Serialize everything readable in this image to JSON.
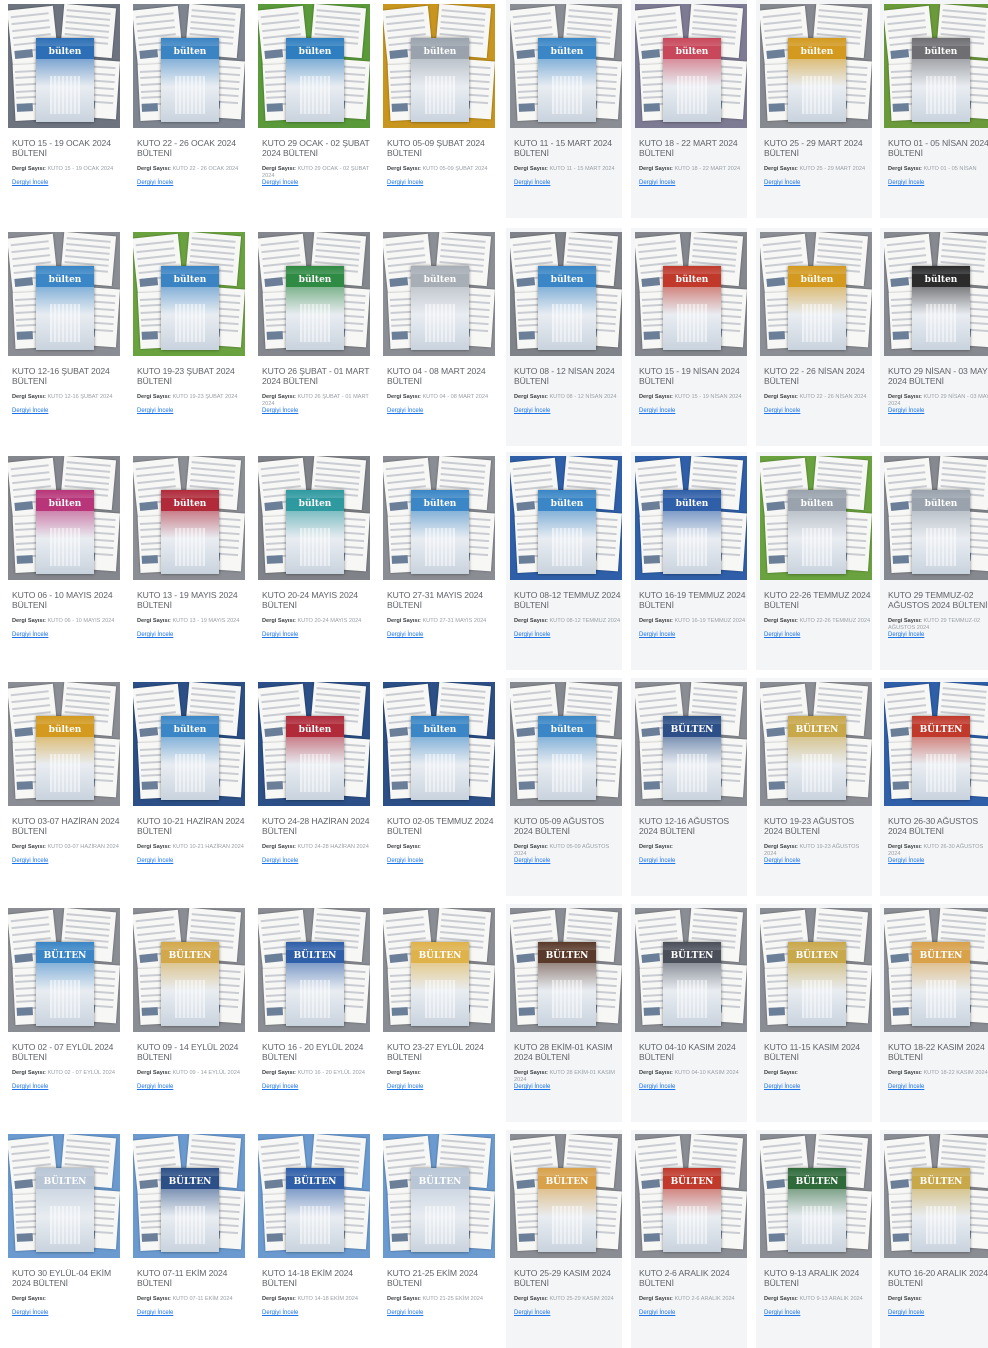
{
  "labels": {
    "issue": "Dergi Sayısı:",
    "link": "Dergiyi İncele"
  },
  "items": [
    {
      "title": "KUTO 15 - 19 OCAK 2024 BÜLTENİ",
      "issue": "KUTO 15 - 19 OCAK 2024",
      "bg": "#6d7480",
      "cover": "#2c6fb6",
      "word": "bülten"
    },
    {
      "title": "KUTO 22 - 26 OCAK 2024 BÜLTENİ",
      "issue": "KUTO 22 - 26 OCAK 2024",
      "bg": "#7e8590",
      "cover": "#3b84c4",
      "word": "bülten"
    },
    {
      "title": "KUTO 29 OCAK - 02 ŞUBAT 2024 BÜLTENİ",
      "issue": "KUTO 29 OCAK - 02 ŞUBAT 2024",
      "bg": "#5a9a3a",
      "cover": "#2f7fc0",
      "word": "bülten"
    },
    {
      "title": "KUTO 05-09 ŞUBAT 2024 BÜLTENİ",
      "issue": "KUTO 05-09 ŞUBAT 2024",
      "bg": "#c8951e",
      "cover": "#9aa3ad",
      "word": "bülten"
    },
    {
      "title": "KUTO 11 - 15 MART 2024 BÜLTENİ",
      "issue": "KUTO 11 - 15 MART 2024",
      "bg": "#8a8d93",
      "cover": "#3a86c6",
      "word": "bülten"
    },
    {
      "title": "KUTO 18 - 22 MART 2024 BÜLTENİ",
      "issue": "KUTO 18 - 22 MART 2024",
      "bg": "#7d7a93",
      "cover": "#c9475a",
      "word": "bülten"
    },
    {
      "title": "KUTO 25 - 29 MART 2024 BÜLTENİ",
      "issue": "KUTO 25 - 29 MART 2024",
      "bg": "#86898f",
      "cover": "#d39a1f",
      "word": "bülten"
    },
    {
      "title": "KUTO 01 - 05 NİSAN 2024 BÜLTENİ",
      "issue": "KUTO 01 - 05 NİSAN",
      "bg": "#6b9a3b",
      "cover": "#6f6f73",
      "word": "bülten"
    },
    {
      "title": "KUTO 12-16 ŞUBAT 2024 BÜLTENİ",
      "issue": "KUTO 12-16 ŞUBAT 2024",
      "bg": "#8a8d93",
      "cover": "#3a86c6",
      "word": "bülten"
    },
    {
      "title": "KUTO 19-23 ŞUBAT 2024 BÜLTENİ",
      "issue": "KUTO 19-23 ŞUBAT 2024",
      "bg": "#6aa23f",
      "cover": "#3b84c4",
      "word": "bülten"
    },
    {
      "title": "KUTO 26 ŞUBAT - 01 MART 2024 BÜLTENİ",
      "issue": "KUTO 26 ŞUBAT - 01 MART 2024",
      "bg": "#84878d",
      "cover": "#2f8a43",
      "word": "bülten"
    },
    {
      "title": "KUTO 04 - 08 MART 2024 BÜLTENİ",
      "issue": "KUTO 04 - 08 MART 2024",
      "bg": "#8b8e94",
      "cover": "#a8aeb6",
      "word": "bülten"
    },
    {
      "title": "KUTO 08 - 12 NİSAN 2024 BÜLTENİ",
      "issue": "KUTO 08 - 12 NİSAN 2024",
      "bg": "#7f8288",
      "cover": "#3a86c6",
      "word": "bülten"
    },
    {
      "title": "KUTO 15 - 19 NİSAN 2024 BÜLTENİ",
      "issue": "KUTO 15 - 19 NİSAN 2024",
      "bg": "#84878d",
      "cover": "#c0392b",
      "word": "bülten"
    },
    {
      "title": "KUTO 22 - 26 NİSAN 2024 BÜLTENİ",
      "issue": "KUTO 22 - 26 NİSAN 2024",
      "bg": "#8b8e94",
      "cover": "#d39a1f",
      "word": "bülten"
    },
    {
      "title": "KUTO 29 NİSAN - 03 MAYIS 2024 BÜLTENİ",
      "issue": "KUTO 29 NİSAN - 03 MAYIS 2024",
      "bg": "#86898f",
      "cover": "#2b2b2b",
      "word": "bülten"
    },
    {
      "title": "KUTO 06 - 10 MAYIS 2024 BÜLTENİ",
      "issue": "KUTO 06 - 10 MAYIS 2024",
      "bg": "#84878d",
      "cover": "#b8357a",
      "word": "bülten"
    },
    {
      "title": "KUTO 13 - 19 MAYIS 2024 BÜLTENİ",
      "issue": "KUTO 13 - 19 MAYIS 2024",
      "bg": "#8b8e94",
      "cover": "#b02a3a",
      "word": "bülten"
    },
    {
      "title": "KUTO 20-24 MAYIS 2024 BÜLTENİ",
      "issue": "KUTO 20-24 MAYIS 2024",
      "bg": "#7f8288",
      "cover": "#2e9aa0",
      "word": "bülten"
    },
    {
      "title": "KUTO 27-31 MAYIS 2024 BÜLTENİ",
      "issue": "KUTO 27-31 MAYIS 2024",
      "bg": "#8a8d93",
      "cover": "#3a86c6",
      "word": "bülten"
    },
    {
      "title": "KUTO 08-12 TEMMUZ 2024 BÜLTENİ",
      "issue": "KUTO 08-12 TEMMUZ 2024",
      "bg": "#2f5fa8",
      "cover": "#3a86c6",
      "word": "bülten"
    },
    {
      "title": "KUTO 16-19 TEMMUZ 2024 BÜLTENİ",
      "issue": "KUTO 16-19 TEMMUZ 2024",
      "bg": "#2f5fa8",
      "cover": "#2f5fa8",
      "word": "bülten"
    },
    {
      "title": "KUTO 22-26 TEMMUZ 2024 BÜLTENİ",
      "issue": "KUTO 22-26 TEMMUZ 2024",
      "bg": "#6aa23f",
      "cover": "#9aa3ad",
      "word": "bülten"
    },
    {
      "title": "KUTO 29 TEMMUZ-02 AĞUSTOS 2024 BÜLTENİ",
      "issue": "KUTO 29 TEMMUZ-02 AĞUSTOS 2024",
      "bg": "#86898f",
      "cover": "#9aa3ad",
      "word": "bülten"
    },
    {
      "title": "KUTO 03-07 HAZİRAN 2024 BÜLTENİ",
      "issue": "KUTO 03-07 HAZİRAN 2024",
      "bg": "#8a8d93",
      "cover": "#d39a1f",
      "word": "bülten"
    },
    {
      "title": "KUTO 10-21 HAZİRAN 2024 BÜLTENİ",
      "issue": "KUTO 10-21 HAZİRAN 2024",
      "bg": "#2b4f86",
      "cover": "#3a86c6",
      "word": "bülten"
    },
    {
      "title": "KUTO 24-28 HAZİRAN 2024 BÜLTENİ",
      "issue": "KUTO 24-28 HAZİRAN 2024",
      "bg": "#2b4f86",
      "cover": "#b02a3a",
      "word": "bülten"
    },
    {
      "title": "KUTO 02-05 TEMMUZ 2024 BÜLTENİ",
      "issue": "",
      "bg": "#2b4f86",
      "cover": "#3a86c6",
      "word": "bülten"
    },
    {
      "title": "KUTO 05-09 AĞUSTOS 2024 BÜLTENİ",
      "issue": "KUTO 05-09 AĞUSTOS 2024",
      "bg": "#86898f",
      "cover": "#3a86c6",
      "word": "bülten"
    },
    {
      "title": "KUTO 12-16 AĞUSTOS 2024 BÜLTENİ",
      "issue": "",
      "bg": "#8a8d93",
      "cover": "#2b4f86",
      "word": "BÜLTEN"
    },
    {
      "title": "KUTO 19-23 AĞUSTOS 2024 BÜLTENİ",
      "issue": "KUTO 19-23 AĞUSTOS 2024",
      "bg": "#8a8d93",
      "cover": "#c9a84a",
      "word": "BÜLTEN"
    },
    {
      "title": "KUTO 26-30 AĞUSTOS 2024 BÜLTENİ",
      "issue": "KUTO 26-30 AĞUSTOS 2024",
      "bg": "#2f5fa8",
      "cover": "#c0392b",
      "word": "BÜLTEN"
    },
    {
      "title": "KUTO 02 - 07 EYLÜL 2024 BÜLTENİ",
      "issue": "KUTO 02 - 07 EYLÜL 2024",
      "bg": "#8a8d93",
      "cover": "#3a86c6",
      "word": "BÜLTEN"
    },
    {
      "title": "KUTO 09 - 14 EYLÜL 2024 BÜLTENİ",
      "issue": "KUTO 09 - 14 EYLÜL 2024",
      "bg": "#8a8d93",
      "cover": "#d3a84a",
      "word": "BÜLTEN"
    },
    {
      "title": "KUTO 16 - 20 EYLÜL 2024 BÜLTENİ",
      "issue": "KUTO 16 - 20 EYLÜL 2024",
      "bg": "#8a8d93",
      "cover": "#2f5fa8",
      "word": "BÜLTEN"
    },
    {
      "title": "KUTO 23-27 EYLÜL 2024 BÜLTENİ",
      "issue": "",
      "bg": "#8a8d93",
      "cover": "#e0b24a",
      "word": "BÜLTEN"
    },
    {
      "title": "KUTO 28 EKİM-01 KASIM 2024 BÜLTENİ",
      "issue": "KUTO 28 EKİM-01 KASIM 2024",
      "bg": "#8a8d93",
      "cover": "#5a3a2a",
      "word": "BÜLTEN"
    },
    {
      "title": "KUTO 04-10 KASIM 2024 BÜLTENİ",
      "issue": "KUTO 04-10 KASIM 2024",
      "bg": "#8a8d93",
      "cover": "#4a4f5a",
      "word": "BÜLTEN"
    },
    {
      "title": "KUTO 11-15 KASIM 2024 BÜLTENİ",
      "issue": "",
      "bg": "#8a8d93",
      "cover": "#c9a84a",
      "word": "BÜLTEN"
    },
    {
      "title": "KUTO 18-22 KASIM 2024 BÜLTENİ",
      "issue": "KUTO 18-22 KASIM 2024",
      "bg": "#8a8d93",
      "cover": "#d9a14a",
      "word": "BÜLTEN"
    },
    {
      "title": "KUTO 30 EYLÜL-04 EKİM 2024 BÜLTENİ",
      "issue": "",
      "bg": "#6a9ad0",
      "cover": "#b8c6d6",
      "word": "BÜLTEN"
    },
    {
      "title": "KUTO 07-11 EKİM 2024 BÜLTENİ",
      "issue": "KUTO 07-11 EKİM 2024",
      "bg": "#6a9ad0",
      "cover": "#2b4f86",
      "word": "BÜLTEN"
    },
    {
      "title": "KUTO 14-18 EKİM 2024 BÜLTENİ",
      "issue": "KUTO 14-18 EKİM 2024",
      "bg": "#6a9ad0",
      "cover": "#2f5fa8",
      "word": "BÜLTEN"
    },
    {
      "title": "KUTO 21-25 EKİM 2024 BÜLTENİ",
      "issue": "KUTO 21-25 EKİM 2024",
      "bg": "#6a9ad0",
      "cover": "#b8c6d6",
      "word": "BÜLTEN"
    },
    {
      "title": "KUTO 25-29 KASIM 2024 BÜLTENİ",
      "issue": "KUTO 25-29 KASIM 2024",
      "bg": "#8a8d93",
      "cover": "#d9a14a",
      "word": "BÜLTEN"
    },
    {
      "title": "KUTO 2-6 ARALIK 2024 BÜLTENİ",
      "issue": "KUTO 2-6 ARALIK 2024",
      "bg": "#8a8d93",
      "cover": "#c0392b",
      "word": "BÜLTEN"
    },
    {
      "title": "KUTO 9-13 ARALIK 2024 BÜLTENİ",
      "issue": "KUTO 9-13 ARALIK 2024",
      "bg": "#8a8d93",
      "cover": "#2f6a3a",
      "word": "BÜLTEN"
    },
    {
      "title": "KUTO 16-20 ARALIK 2024 BÜLTENİ",
      "issue": "",
      "bg": "#8a8d93",
      "cover": "#c9a84a",
      "word": "BÜLTEN"
    }
  ]
}
